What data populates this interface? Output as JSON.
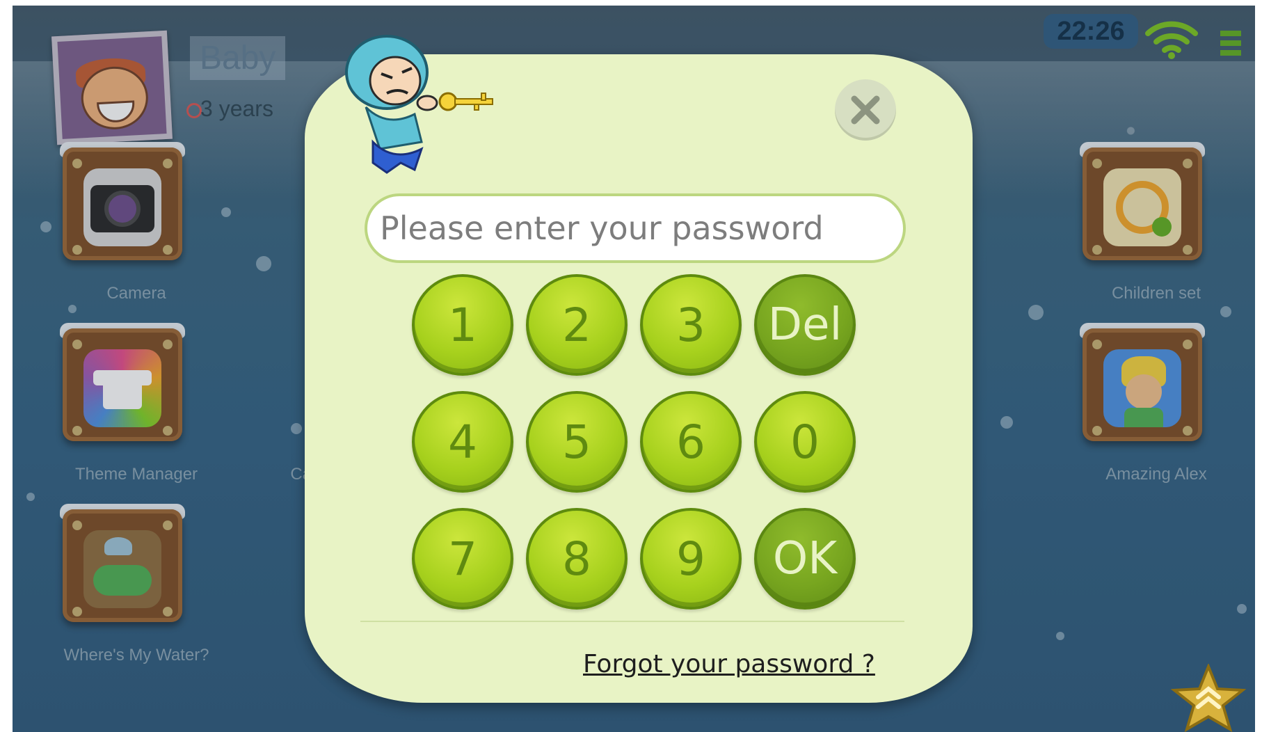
{
  "status_bar": {
    "time": "22:26",
    "icons": [
      "wifi-icon",
      "battery-icon"
    ]
  },
  "profile": {
    "name": "Baby",
    "age": "3 years"
  },
  "apps": {
    "left": [
      {
        "label": "Camera",
        "icon": "camera-icon"
      },
      {
        "label": "Theme Manager",
        "icon": "tshirt-icon"
      },
      {
        "label": "Where's My Water?",
        "icon": "crocodile-icon"
      }
    ],
    "middle_partial": [
      {
        "label": "Ca",
        "icon": ""
      }
    ],
    "right": [
      {
        "label": "Children set",
        "icon": "children-settings-icon"
      },
      {
        "label": "Amazing Alex",
        "icon": "amazing-alex-icon"
      }
    ]
  },
  "dialog": {
    "password": {
      "placeholder": "Please enter your password",
      "value": ""
    },
    "keypad": {
      "rows": [
        [
          "1",
          "2",
          "3",
          "Del"
        ],
        [
          "4",
          "5",
          "6",
          "0"
        ],
        [
          "7",
          "8",
          "9",
          "OK"
        ]
      ]
    },
    "forgot_link": "Forgot your password ?",
    "close_icon": "close-icon",
    "mascot_icon": "key-thief-mascot"
  },
  "colors": {
    "dialog_bg": "#e8f3c5",
    "key_green": "#a7d11d",
    "key_action": "#77a51f",
    "background": "#2d5e80"
  }
}
